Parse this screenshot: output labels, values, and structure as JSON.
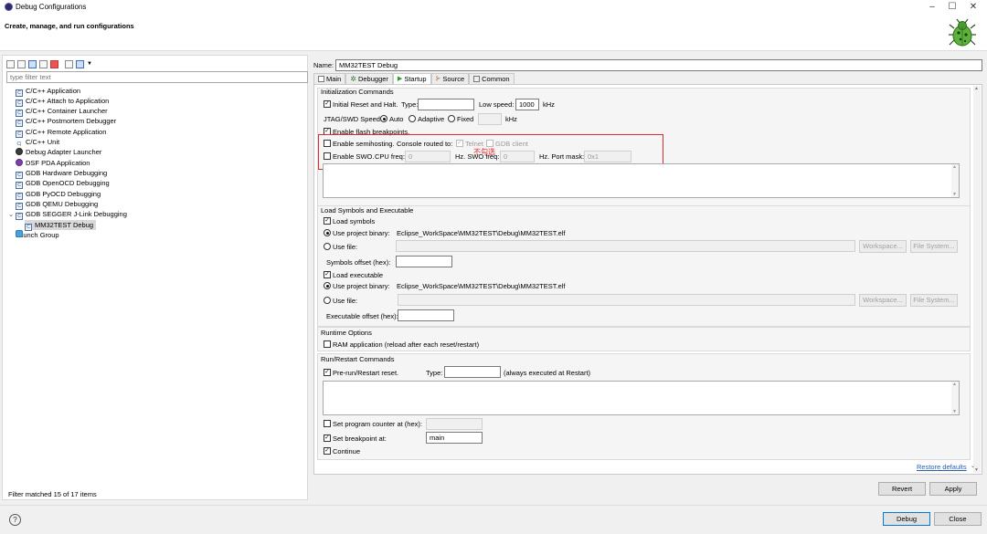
{
  "window": {
    "title": "Debug Configurations",
    "subtitle": "Create, manage, and run configurations"
  },
  "left": {
    "filter_placeholder": "type filter text",
    "items": [
      {
        "label": "C/C++ Application",
        "icon": "c-icon"
      },
      {
        "label": "C/C++ Attach to Application",
        "icon": "c-icon"
      },
      {
        "label": "C/C++ Container Launcher",
        "icon": "c-icon"
      },
      {
        "label": "C/C++ Postmortem Debugger",
        "icon": "c-icon"
      },
      {
        "label": "C/C++ Remote Application",
        "icon": "c-icon"
      },
      {
        "label": "C/C++ Unit",
        "icon": "cu-icon"
      },
      {
        "label": "Debug Adapter Launcher",
        "icon": "bug-icon"
      },
      {
        "label": "DSF PDA Application",
        "icon": "dsf-icon"
      },
      {
        "label": "GDB Hardware Debugging",
        "icon": "c-icon"
      },
      {
        "label": "GDB OpenOCD Debugging",
        "icon": "c-icon"
      },
      {
        "label": "GDB PyOCD Debugging",
        "icon": "c-icon"
      },
      {
        "label": "GDB QEMU Debugging",
        "icon": "c-icon"
      },
      {
        "label": "GDB SEGGER J-Link Debugging",
        "icon": "c-icon"
      },
      {
        "label": "MM32TEST Debug",
        "icon": "c-icon"
      },
      {
        "label": "Launch Group",
        "icon": "group-icon"
      }
    ],
    "footer": "Filter matched 15 of 17 items"
  },
  "right": {
    "name_label": "Name:",
    "name_value": "MM32TEST Debug",
    "tabs": [
      "Main",
      "Debugger",
      "Startup",
      "Source",
      "Common"
    ],
    "init": {
      "title": "Initialization Commands",
      "reset_label": "Initial Reset and Halt.",
      "type_label": "Type:",
      "type_value": "",
      "low_speed_label": "Low speed:",
      "low_speed_value": "1000",
      "khz": "kHz",
      "jtag_label": "JTAG/SWD Speed:",
      "auto": "Auto",
      "adaptive": "Adaptive",
      "fixed": "Fixed",
      "fixed_khz": "kHz",
      "flash_label": "Enable flash breakpoints.",
      "semi_label": "Enable semihosting.",
      "console_label": "Console routed to:",
      "telnet": "Telnet",
      "gdbclient": "GDB client",
      "swo_label": "Enable SWO.",
      "cpu_freq_label": "CPU freq:",
      "cpu_freq_value": "0",
      "hz_swo_label": "Hz. SWO freq:",
      "swo_freq_value": "0",
      "hz_port_label": "Hz. Port mask:",
      "port_mask_value": "0x1",
      "annotation": "不勾选"
    },
    "load": {
      "title": "Load Symbols and Executable",
      "load_symbols": "Load symbols",
      "use_project_binary": "Use project binary:",
      "symbols_binary": "Eclipse_WorkSpace\\MM32TEST\\Debug\\MM32TEST.elf",
      "use_file": "Use file:",
      "workspace": "Workspace...",
      "filesystem": "File System...",
      "symbols_offset": "Symbols offset (hex):",
      "load_executable": "Load executable",
      "exe_binary": "Eclipse_WorkSpace\\MM32TEST\\Debug\\MM32TEST.elf",
      "exe_offset": "Executable offset (hex):"
    },
    "runtime": {
      "title": "Runtime Options",
      "ram_app": "RAM application (reload after each reset/restart)"
    },
    "restart": {
      "title": "Run/Restart Commands",
      "prerun": "Pre-run/Restart reset.",
      "type_label": "Type:",
      "always": "(always executed at Restart)",
      "set_pc": "Set program counter at (hex):",
      "set_bp": "Set breakpoint at:",
      "bp_value": "main",
      "continue": "Continue"
    },
    "restore_defaults": "Restore defaults",
    "revert": "Revert",
    "apply": "Apply"
  },
  "footer": {
    "help": "?",
    "debug": "Debug",
    "close": "Close"
  }
}
